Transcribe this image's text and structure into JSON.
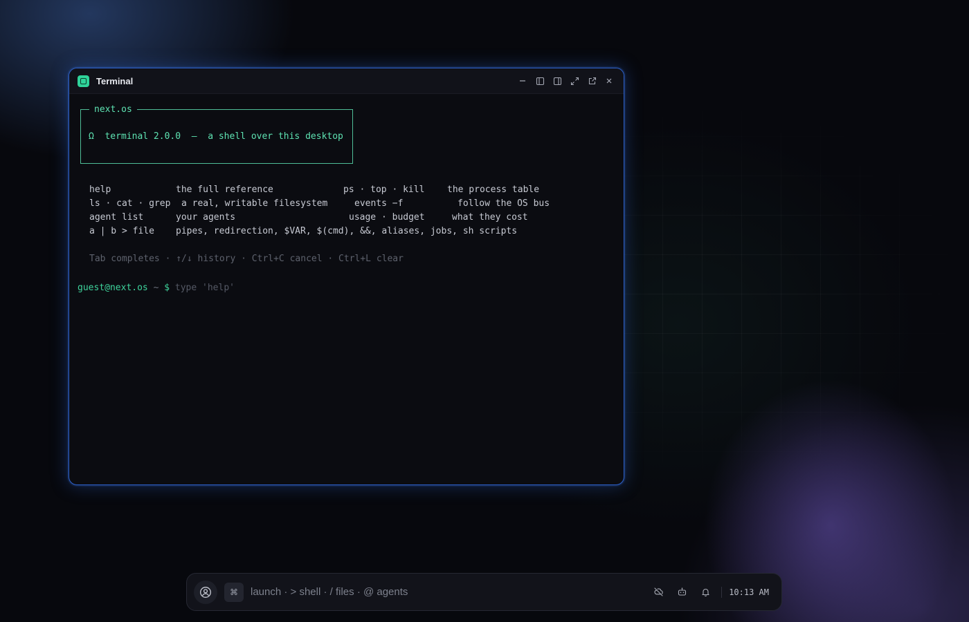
{
  "window": {
    "title": "Terminal",
    "controls": [
      "minimize-icon",
      "snap-left-icon",
      "snap-right-icon",
      "maximize-icon",
      "popout-icon",
      "close-icon"
    ]
  },
  "terminal": {
    "banner": {
      "title": "next.os",
      "omega": "Ω",
      "version_text": "terminal 2.0.0",
      "dash": "—",
      "tagline": "a shell over this desktop",
      "color": "#5ee3b2"
    },
    "help_rows": [
      {
        "cmd1": "help",
        "desc1": "the full reference",
        "cmd2": "ps · top · kill",
        "desc2": "the process table"
      },
      {
        "cmd1": "ls · cat · grep",
        "desc1": "a real, writable filesystem",
        "cmd2": "events −f",
        "desc2": "follow the OS bus"
      },
      {
        "cmd1": "agent list",
        "desc1": "your agents",
        "cmd2": "usage · budget",
        "desc2": "what they cost"
      },
      {
        "cmd1": "a | b > file",
        "desc1": "pipes, redirection, $VAR, $(cmd), &&, aliases, jobs, sh scripts",
        "cmd2": "",
        "desc2": ""
      }
    ],
    "hint": "Tab completes · ↑/↓ history · Ctrl+C cancel · Ctrl+L clear",
    "prompt": {
      "user_host": "guest@next.os",
      "path": "~",
      "symbol": "$",
      "value": "",
      "placeholder": "type 'help'"
    }
  },
  "taskbar": {
    "avatar_icon": "user-circle-icon",
    "cmd_key": "⌘",
    "launcher_hint": "launch · > shell · / files · @ agents",
    "tray_icons": [
      "cloud-off-icon",
      "robot-icon",
      "bell-icon"
    ],
    "clock": "10:13 AM"
  },
  "colors": {
    "accent_green": "#3ed49c",
    "window_border": "#2b5ec6",
    "app_icon": "#2fd39a"
  }
}
